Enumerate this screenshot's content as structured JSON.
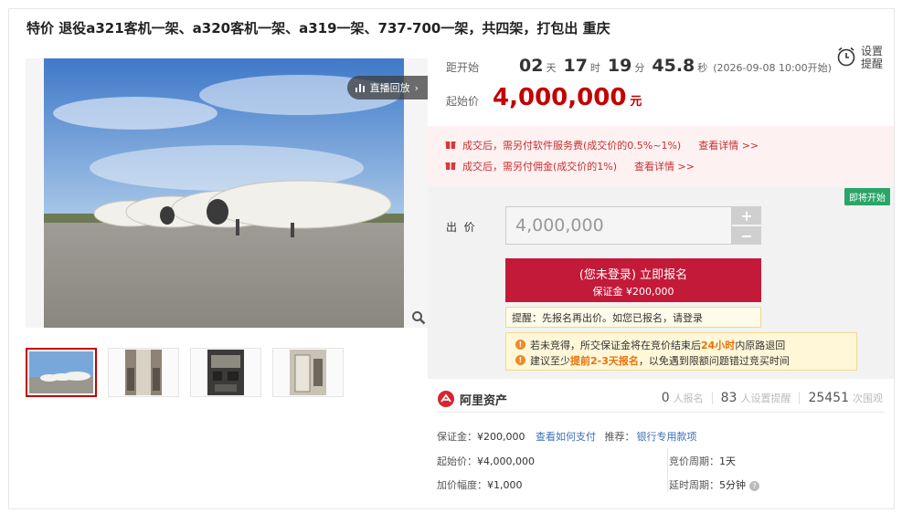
{
  "title": "特价 退役a321客机一架、a320客机一架、a319一架、737-700一架，共四架，打包出 重庆",
  "image": {
    "live_label": "直播回放",
    "live_arrow": "›",
    "thumb_count": 4
  },
  "countdown": {
    "label": "距开始",
    "days": "02",
    "days_unit": "天",
    "hours": "17",
    "hours_unit": "时",
    "minutes": "19",
    "minutes_unit": "分",
    "seconds": "45.8",
    "seconds_unit": "秒",
    "start_time": "(2026-09-08 10:00开始)"
  },
  "reminder": {
    "label": "设置提醒"
  },
  "start_price": {
    "label": "起始价",
    "value": "4,000,000",
    "unit": "元"
  },
  "notices": [
    {
      "text": "成交后，需另付软件服务费(成交价的0.5%~1%)",
      "link": "查看详情 >>"
    },
    {
      "text": "成交后，需另付佣金(成交价的1%)",
      "link": "查看详情 >>"
    }
  ],
  "status_badge": "即将开始",
  "bid": {
    "label": "出  价",
    "value": "4,000,000",
    "plus": "+",
    "minus": "−"
  },
  "signup": {
    "line1": "(您未登录) 立即报名",
    "line2": "保证金 ¥200,000"
  },
  "tip": {
    "text": "提醒：先报名再出价。如您已报名，请",
    "link": "登录"
  },
  "warnings": [
    {
      "pre": "若未竞得，所交保证金将在竞价结束后",
      "hl": "24小时",
      "post": "内原路退回"
    },
    {
      "pre": "建议至少",
      "hl": "提前2-3天报名",
      "post": "，以免遇到限额问题错过竞买时间"
    }
  ],
  "platform": {
    "name": "阿里资产",
    "signups": "0",
    "signups_label": "人报名",
    "reminders": "83",
    "reminders_label": "人设置提醒",
    "views": "25451",
    "views_label": "次围观"
  },
  "details": {
    "deposit_label": "保证金：",
    "deposit_value": "¥200,000",
    "deposit_link": "查看如何支付",
    "recommend_label": "推荐：",
    "recommend_link": "银行专用款项",
    "start_label": "起始价：",
    "start_value": "¥4,000,000",
    "increment_label": "加价幅度：",
    "increment_value": "¥1,000",
    "cycle_label": "竞价周期：",
    "cycle_value": "1天",
    "extend_label": "延时周期：",
    "extend_value": "5分钟",
    "help": "?"
  },
  "colors": {
    "accent_red": "#c40000",
    "button_red": "#c41a3a",
    "status_green": "#2aa567",
    "link_blue": "#3b6fb7",
    "warn_orange": "#e8720c"
  }
}
